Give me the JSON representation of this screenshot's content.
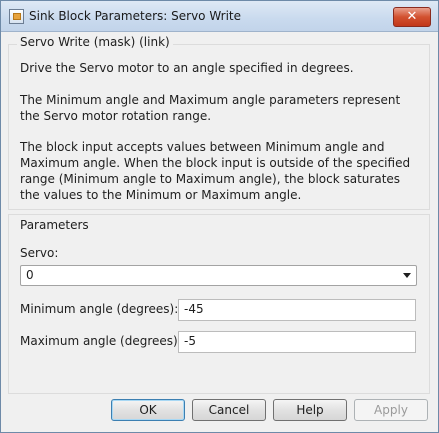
{
  "window": {
    "title": "Sink Block Parameters: Servo Write",
    "close_glyph": "✕"
  },
  "mask": {
    "group_title": "Servo Write (mask) (link)",
    "description": [
      "Drive the Servo motor to an angle specified in degrees.",
      "The Minimum angle and Maximum angle parameters represent the Servo motor rotation range.",
      "The block input accepts values between Minimum angle and Maximum angle. When the block input is outside of the specified range (Minimum angle to Maximum angle), the block saturates the values to the Minimum or Maximum angle."
    ]
  },
  "parameters": {
    "group_title": "Parameters",
    "servo_label": "Servo:",
    "servo_value": "0",
    "min_label": "Minimum angle (degrees):",
    "min_value": "-45",
    "max_label": "Maximum angle (degrees):",
    "max_value": "-5"
  },
  "buttons": {
    "ok": "OK",
    "cancel": "Cancel",
    "help": "Help",
    "apply": "Apply"
  }
}
